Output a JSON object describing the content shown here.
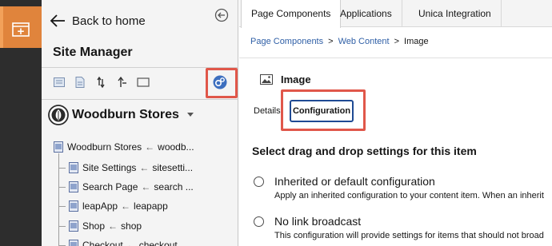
{
  "rail": {
    "items": [
      {
        "icon": "add-content-icon",
        "active": true
      }
    ],
    "accent_color": "#e0843c"
  },
  "site_manager": {
    "back_label": "Back to home",
    "title": "Site Manager",
    "toolbar_icons": [
      "new-page-icon",
      "new-content-icon",
      "move-icon",
      "move-up-icon",
      "frame-icon",
      "settings-gear-icon"
    ],
    "site_name": "Woodburn Stores",
    "tree": [
      {
        "label": "Woodburn Stores",
        "arrow": "←",
        "target": "woodb..."
      },
      {
        "label": "Site Settings",
        "arrow": "←",
        "target": "sitesetti..."
      },
      {
        "label": "Search Page",
        "arrow": "←",
        "target": "search ..."
      },
      {
        "label": "leapApp",
        "arrow": "←",
        "target": "leapapp"
      },
      {
        "label": "Shop",
        "arrow": "←",
        "target": "shop"
      },
      {
        "label": "Checkout",
        "arrow": "←",
        "target": "checkout"
      }
    ]
  },
  "content": {
    "tabs": [
      {
        "label": "Page Components",
        "active": true
      },
      {
        "label": "Applications",
        "active": false
      },
      {
        "label": "Unica Integration",
        "active": false
      }
    ],
    "breadcrumb": {
      "items": [
        "Page Components",
        "Web Content"
      ],
      "separator": ">",
      "current": "Image"
    },
    "item_title": "Image",
    "detail_tabs": [
      {
        "label": "Details",
        "active": false
      },
      {
        "label": "Configuration",
        "active": true
      }
    ],
    "section_title": "Select drag and drop settings for this item",
    "options": [
      {
        "label": "Inherited or default configuration",
        "description": "Apply an inherited configuration to your content item. When an inherit"
      },
      {
        "label": "No link broadcast",
        "description": "This configuration will provide settings for items that should not broad"
      }
    ]
  },
  "colors": {
    "highlight": "#e0574a",
    "link": "#2f5fa6",
    "focus_border": "#1f4a93"
  }
}
